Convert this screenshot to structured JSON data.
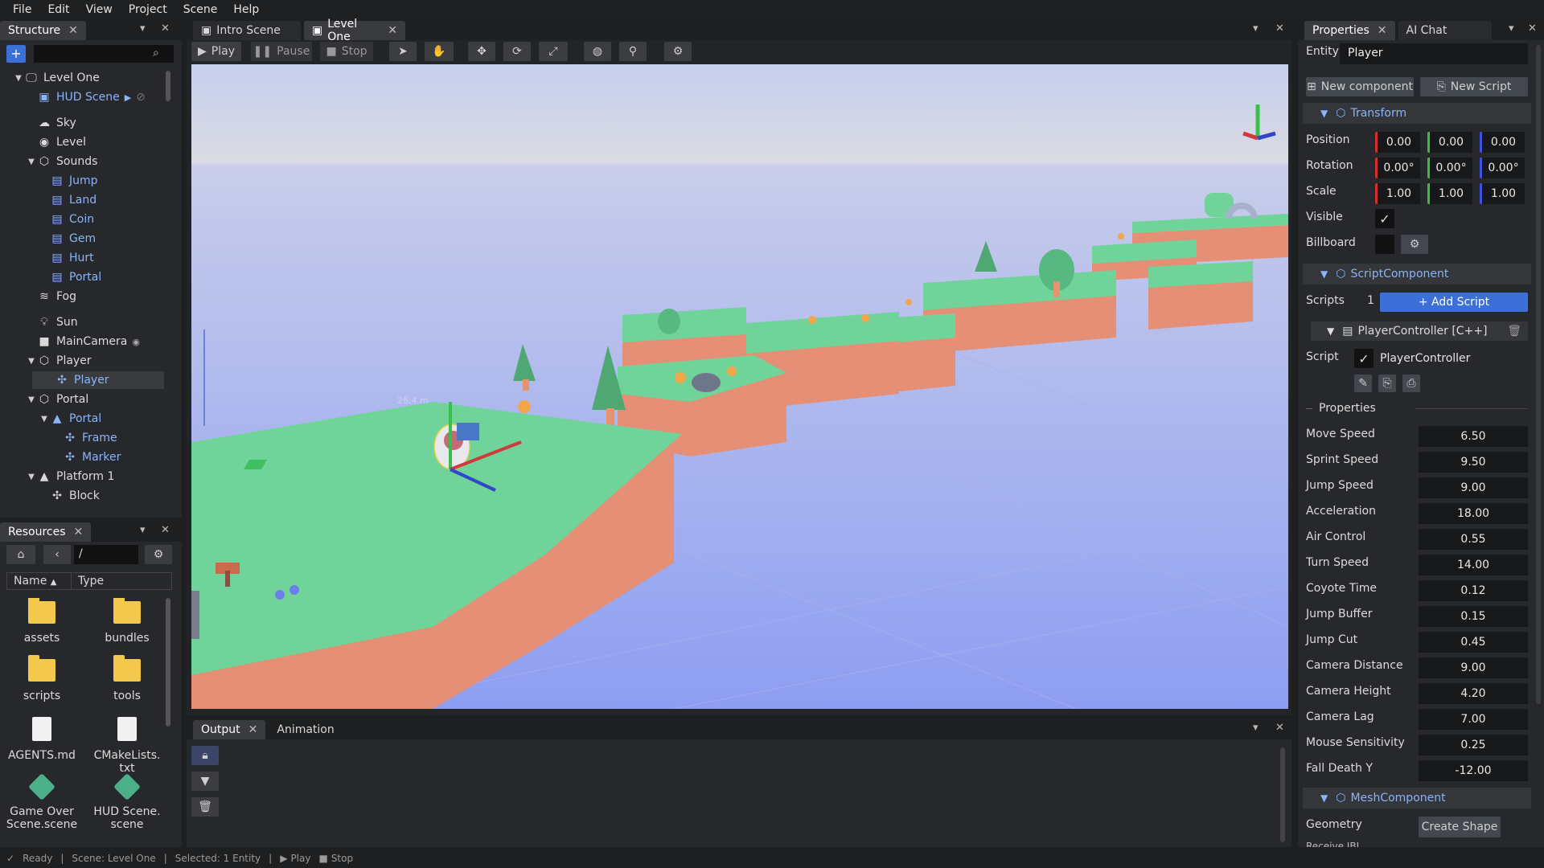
{
  "menu": [
    "File",
    "Edit",
    "View",
    "Project",
    "Scene",
    "Help"
  ],
  "structure": {
    "tab": "Structure",
    "add": "+",
    "search_placeholder": "",
    "items": [
      {
        "label": "Level One",
        "expander": "▼",
        "icon": "monitor-icon",
        "depth": 0
      },
      {
        "label": "HUD Scene",
        "expander": "",
        "icon": "scene-icon",
        "depth": 1,
        "blue": true
      },
      {
        "label": "Sky",
        "expander": "",
        "icon": "cloud-icon",
        "depth": 1
      },
      {
        "label": "Level",
        "expander": "",
        "icon": "circle-icon",
        "depth": 1
      },
      {
        "label": "Sounds",
        "expander": "▼",
        "icon": "box-icon",
        "depth": 1
      },
      {
        "label": "Jump",
        "expander": "",
        "icon": "sound-file-icon",
        "depth": 2,
        "blue": true
      },
      {
        "label": "Land",
        "expander": "",
        "icon": "sound-file-icon",
        "depth": 2,
        "blue": true
      },
      {
        "label": "Coin",
        "expander": "",
        "icon": "sound-file-icon",
        "depth": 2,
        "blue": true
      },
      {
        "label": "Gem",
        "expander": "",
        "icon": "sound-file-icon",
        "depth": 2,
        "blue": true
      },
      {
        "label": "Hurt",
        "expander": "",
        "icon": "sound-file-icon",
        "depth": 2,
        "blue": true
      },
      {
        "label": "Portal",
        "expander": "",
        "icon": "sound-file-icon",
        "depth": 2,
        "blue": true
      },
      {
        "label": "Fog",
        "expander": "",
        "icon": "fog-icon",
        "depth": 1
      },
      {
        "label": "Sun",
        "expander": "",
        "icon": "bulb-icon",
        "depth": 1
      },
      {
        "label": "MainCamera",
        "expander": "",
        "icon": "camera-icon",
        "depth": 1
      },
      {
        "label": "Player",
        "expander": "▼",
        "icon": "box-icon",
        "depth": 1
      },
      {
        "label": "Player",
        "expander": "",
        "icon": "figure-icon",
        "depth": 2,
        "blue": true
      },
      {
        "label": "Portal",
        "expander": "▼",
        "icon": "box-icon",
        "depth": 1
      },
      {
        "label": "Portal",
        "expander": "▼",
        "icon": "mesh-icon",
        "depth": 2,
        "blue": true
      },
      {
        "label": "Frame",
        "expander": "",
        "icon": "figure-icon",
        "depth": 3,
        "blue": true
      },
      {
        "label": "Marker",
        "expander": "",
        "icon": "figure-icon",
        "depth": 3,
        "blue": true
      },
      {
        "label": "Platform 1",
        "expander": "▼",
        "icon": "mesh-icon",
        "depth": 1
      },
      {
        "label": "Block",
        "expander": "",
        "icon": "figure-icon",
        "depth": 2
      }
    ]
  },
  "resources": {
    "tab": "Resources",
    "path": "/",
    "col_name": "Name",
    "col_type": "Type",
    "items": [
      {
        "label": "assets",
        "kind": "folder"
      },
      {
        "label": "bundles",
        "kind": "folder"
      },
      {
        "label": "scripts",
        "kind": "folder"
      },
      {
        "label": "tools",
        "kind": "folder"
      },
      {
        "label": "AGENTS.md",
        "kind": "file"
      },
      {
        "label": "CMakeLists.\ntxt",
        "kind": "file"
      },
      {
        "label": "Game Over\nScene.scene",
        "kind": "scene"
      },
      {
        "label": "HUD Scene.\nscene",
        "kind": "scene"
      }
    ]
  },
  "viewport": {
    "tabs": [
      "Intro Scene",
      "Level One"
    ],
    "play": "Play",
    "pause": "Pause",
    "stop": "Stop",
    "distance": "26.4 m"
  },
  "output": {
    "tabs": [
      "Output",
      "Animation"
    ]
  },
  "properties": {
    "tabs": [
      "Properties",
      "AI Chat"
    ],
    "entity_label": "Entity",
    "entity_value": "Player",
    "new_component": "New component",
    "new_script": "New Script",
    "transform": "Transform",
    "position_label": "Position",
    "position": [
      "0.00",
      "0.00",
      "0.00"
    ],
    "rotation_label": "Rotation",
    "rotation": [
      "0.00°",
      "0.00°",
      "0.00°"
    ],
    "scale_label": "Scale",
    "scale": [
      "1.00",
      "1.00",
      "1.00"
    ],
    "visible_label": "Visible",
    "billboard_label": "Billboard",
    "script_component": "ScriptComponent",
    "scripts_label": "Scripts",
    "scripts_count": "1",
    "add_script": "+ Add Script",
    "controller_title": "PlayerController [C++]",
    "script_label": "Script",
    "script_name": "PlayerController",
    "props_header": "Properties",
    "fields": [
      {
        "label": "Move Speed",
        "value": "6.50"
      },
      {
        "label": "Sprint Speed",
        "value": "9.50"
      },
      {
        "label": "Jump Speed",
        "value": "9.00"
      },
      {
        "label": "Acceleration",
        "value": "18.00"
      },
      {
        "label": "Air Control",
        "value": "0.55"
      },
      {
        "label": "Turn Speed",
        "value": "14.00"
      },
      {
        "label": "Coyote Time",
        "value": "0.12"
      },
      {
        "label": "Jump Buffer",
        "value": "0.15"
      },
      {
        "label": "Jump Cut",
        "value": "0.45"
      },
      {
        "label": "Camera Distance",
        "value": "9.00"
      },
      {
        "label": "Camera Height",
        "value": "4.20"
      },
      {
        "label": "Camera Lag",
        "value": "7.00"
      },
      {
        "label": "Mouse Sensitivity",
        "value": "0.25"
      },
      {
        "label": "Fall Death Y",
        "value": "-12.00"
      }
    ],
    "mesh_component": "MeshComponent",
    "geometry_label": "Geometry",
    "create_shape": "Create Shape",
    "receive_label": "Receive IBL"
  },
  "status": {
    "ready": "Ready",
    "scene": "Scene: Level One",
    "selected": "Selected: 1 Entity",
    "play": "Play",
    "stop": "Stop"
  },
  "colors": {
    "accent": "#8ab4f8",
    "grass": "#5fcf8f",
    "dirt": "#e08a6b",
    "sky_top": "#c7d2ee",
    "sky_bottom": "#8f9ff0"
  }
}
